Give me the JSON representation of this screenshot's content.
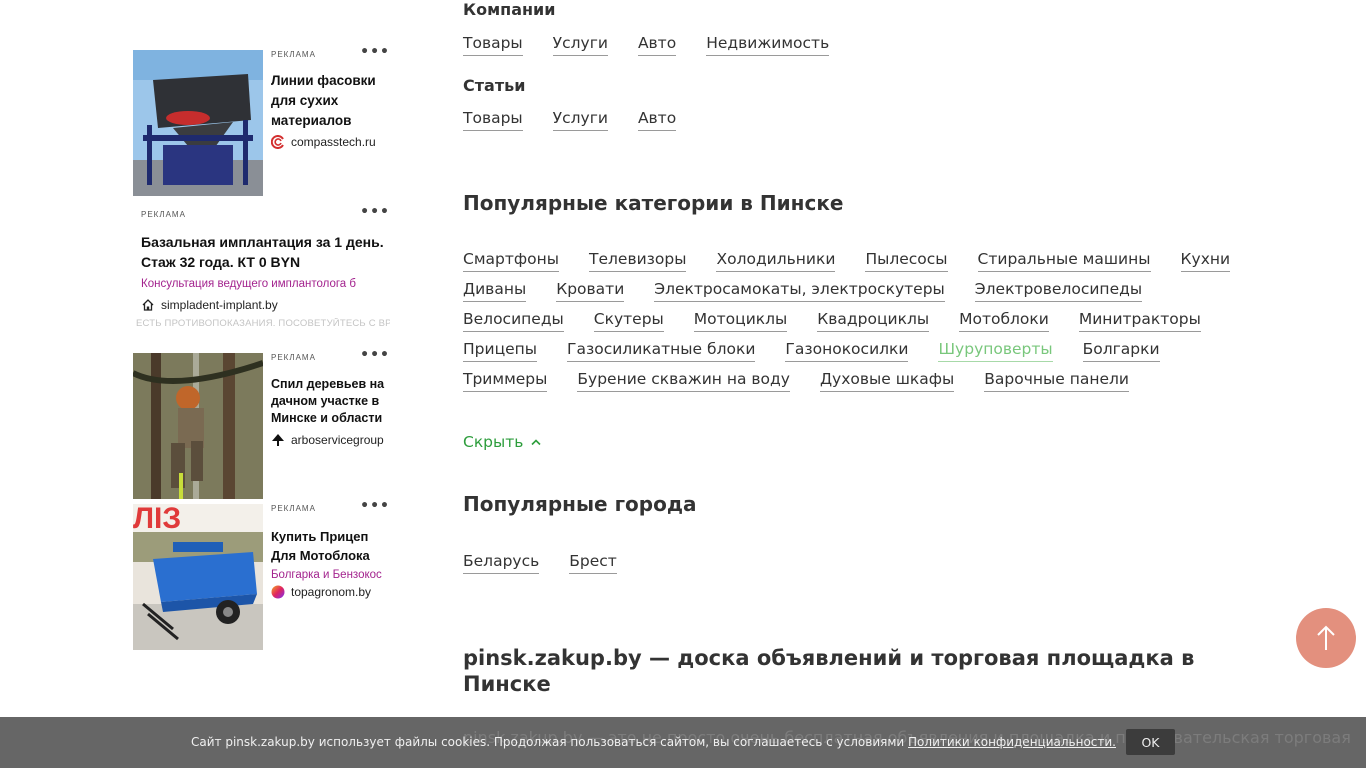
{
  "ads": [
    {
      "label": "РЕКЛАМА",
      "title": "Линии фасовки для сухих материалов",
      "domain": "compasstech.ru",
      "icon": "compass-logo-icon"
    },
    {
      "label": "РЕКЛАМА",
      "title": "Базальная имплантация за 1 день. Стаж 32 года. КТ 0 BYN",
      "subtitle": "Консультация ведущего имплантолога б",
      "domain": "simpladent-implant.by",
      "icon": "home-icon",
      "disclaimer": "ЕСТЬ ПРОТИВОПОКАЗАНИЯ. ПОСОВЕТУЙТЕСЬ С ВРАЧОМ."
    },
    {
      "label": "РЕКЛАМА",
      "title": "Спил деревьев на дачном участке в Минске и области",
      "domain": "arboservicegroup",
      "icon": "tree-icon"
    },
    {
      "label": "РЕКЛАМА",
      "title": "Купить Прицеп Для Мотоблока",
      "subtitle": "Болгарка и Бензокос",
      "domain": "topagronom.by",
      "icon": "topagronom-logo-icon"
    }
  ],
  "sections": {
    "companies": {
      "title": "Компании",
      "links": [
        "Товары",
        "Услуги",
        "Авто",
        "Недвижимость"
      ]
    },
    "articles": {
      "title": "Статьи",
      "links": [
        "Товары",
        "Услуги",
        "Авто"
      ]
    }
  },
  "popular_categories": {
    "title": "Популярные категории в Пинске",
    "links": [
      "Смартфоны",
      "Телевизоры",
      "Холодильники",
      "Пылесосы",
      "Стиральные машины",
      "Кухни",
      "Диваны",
      "Кровати",
      "Электросамокаты, электроскутеры",
      "Электровелосипеды",
      "Велосипеды",
      "Скутеры",
      "Мотоциклы",
      "Квадроциклы",
      "Мотоблоки",
      "Минитракторы",
      "Прицепы",
      "Газосиликатные блоки",
      "Газонокосилки",
      "Шуруповерты",
      "Болгарки",
      "Триммеры",
      "Бурение скважин на воду",
      "Духовые шкафы",
      "Варочные панели"
    ],
    "active_link": "Шуруповерты",
    "hide_label": "Скрыть"
  },
  "popular_cities": {
    "title": "Популярные города",
    "links": [
      "Беларусь",
      "Брест"
    ]
  },
  "site_title": "pinsk.zakup.by — доска объявлений и торговая площадка в Пинске",
  "site_text_partial": "pinsk.zakup.by — это не просто очень бесплатная объявления и площадка и пользовательская торговая",
  "cookie": {
    "text": "Сайт pinsk.zakup.by использует файлы cookies. Продолжая пользоваться сайтом, вы соглашаетесь с условиями",
    "link": "Политики конфиденциальности.",
    "ok": "OK"
  },
  "colors": {
    "accent_green": "#2d9d3c",
    "active_link": "#79c77c",
    "scroll_button": "#e3907e",
    "ad_subtitle": "#a3238e"
  }
}
